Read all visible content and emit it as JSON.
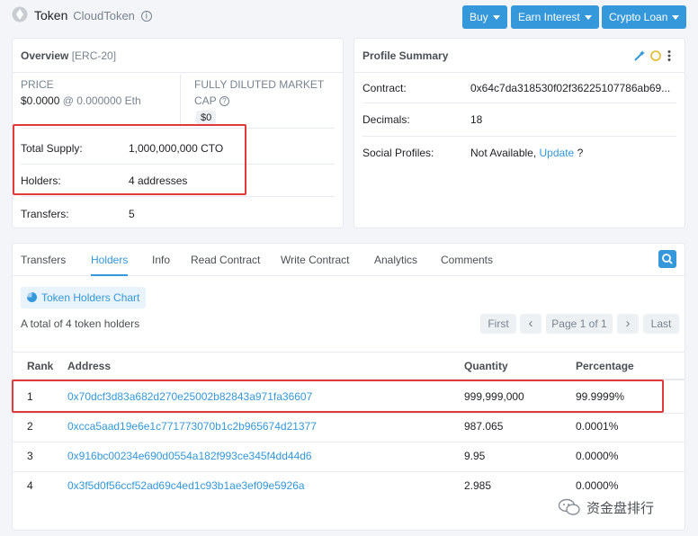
{
  "header": {
    "title": "Token",
    "subtitle": "CloudToken",
    "info_glyph": "i",
    "buttons": [
      {
        "label": "Buy"
      },
      {
        "label": "Earn Interest"
      },
      {
        "label": "Crypto Loan"
      }
    ]
  },
  "overview": {
    "title": "Overview",
    "standard": "[ERC-20]",
    "price_label": "PRICE",
    "price_value": "$0.0000",
    "price_eth": "@ 0.000000 Eth",
    "fdmc_label_1": "FULLY DILUTED MARKET",
    "fdmc_label_2": "CAP",
    "fdmc_value": "$0",
    "rows": [
      {
        "label": "Total Supply:",
        "value": "1,000,000,000 CTO"
      },
      {
        "label": "Holders:",
        "value": "4 addresses"
      },
      {
        "label": "Transfers:",
        "value": "5"
      }
    ]
  },
  "profile": {
    "title": "Profile Summary",
    "rows": [
      {
        "label": "Contract:",
        "value": "0x64c7da318530f02f36225107786ab69..."
      },
      {
        "label": "Decimals:",
        "value": "18"
      },
      {
        "label": "Social Profiles:",
        "value": "Not Available,",
        "link": "Update",
        "suffix": "?"
      }
    ]
  },
  "tabs": [
    {
      "label": "Transfers"
    },
    {
      "label": "Holders"
    },
    {
      "label": "Info"
    },
    {
      "label": "Read Contract"
    },
    {
      "label": "Write Contract"
    },
    {
      "label": "Analytics"
    },
    {
      "label": "Comments"
    }
  ],
  "holders": {
    "chart_button": "Token Holders Chart",
    "total_text": "A total of 4 token holders",
    "pagination": {
      "first": "First",
      "prev": "‹",
      "page": "Page 1 of 1",
      "next": "›",
      "last": "Last"
    },
    "columns": [
      "Rank",
      "Address",
      "Quantity",
      "Percentage"
    ],
    "rows": [
      {
        "rank": "1",
        "address": "0x70dcf3d83a682d270e25002b82843a971fa36607",
        "quantity": "999,999,000",
        "percentage": "99.9999%"
      },
      {
        "rank": "2",
        "address": "0xcca5aad19e6e1c771773070b1c2b965674d21377",
        "quantity": "987.065",
        "percentage": "0.0001%"
      },
      {
        "rank": "3",
        "address": "0x916bc00234e690d0554a182f993ce345f4dd44d6",
        "quantity": "9.95",
        "percentage": "0.0000%"
      },
      {
        "rank": "4",
        "address": "0x3f5d0f56ccf52ad69c4ed1c93b1ae3ef09e5926a",
        "quantity": "2.985",
        "percentage": "0.0000%"
      }
    ]
  },
  "watermark": {
    "text": "资金盘排行"
  },
  "colors": {
    "accent": "#3498db",
    "highlight": "#e23a3a"
  }
}
